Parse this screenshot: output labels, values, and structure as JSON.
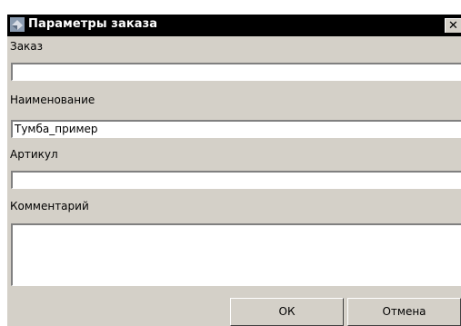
{
  "window": {
    "title": "Параметры заказа",
    "close_glyph": "✕",
    "icon": "app-icon"
  },
  "fields": {
    "order": {
      "label": "Заказ",
      "value": ""
    },
    "name": {
      "label": "Наименование",
      "value": "Тумба_пример"
    },
    "article": {
      "label": "Артикул",
      "value": ""
    },
    "comment": {
      "label": "Комментарий",
      "value": ""
    }
  },
  "buttons": {
    "ok_label": "ОК",
    "cancel_label": "Отмена"
  }
}
